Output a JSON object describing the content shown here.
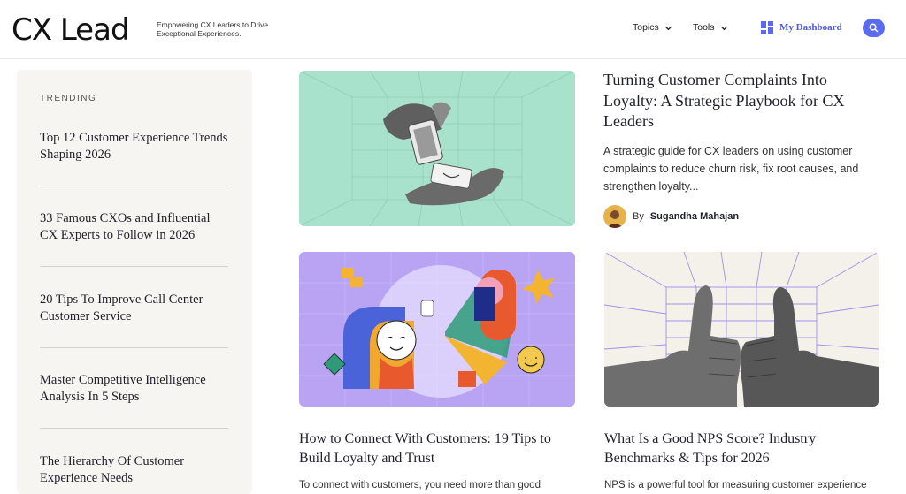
{
  "header": {
    "logo": "CX Lead",
    "tagline": "Empowering CX Leaders to Drive Exceptional Experiences.",
    "nav": [
      "Topics",
      "Tools"
    ],
    "dashboard_label": "My Dashboard"
  },
  "sidebar": {
    "heading": "TRENDING",
    "items": [
      "Top 12 Customer Experience Trends Shaping 2026",
      "33 Famous CXOs and Influential CX Experts to Follow in 2026",
      "20 Tips To Improve Call Center Customer Service",
      "Master Competitive Intelligence Analysis In 5 Steps",
      "The Hierarchy Of Customer Experience Needs"
    ]
  },
  "featured": {
    "title": "Turning Customer Complaints Into Loyalty: A Strategic Playbook for CX Leaders",
    "excerpt": "A strategic guide for CX leaders on using customer complaints to reduce churn risk, fix root causes, and strengthen loyalty...",
    "author_prefix": "By",
    "author": "Sugandha Mahajan"
  },
  "articles": [
    {
      "title": "How to Connect With Customers: 19 Tips to Build Loyalty and Trust",
      "excerpt": "To connect with customers, you need more than good"
    },
    {
      "title": "What Is a Good NPS Score? Industry Benchmarks & Tips for 2026",
      "excerpt": "NPS is a powerful tool for measuring customer experience"
    }
  ],
  "colors": {
    "accent": "#5b6bf0",
    "sidebar_bg": "#f7f5f1",
    "card1_bg": "#a8e2cc",
    "card2_bg": "#b8a4f2",
    "card3_bg": "#f4f1ea"
  }
}
